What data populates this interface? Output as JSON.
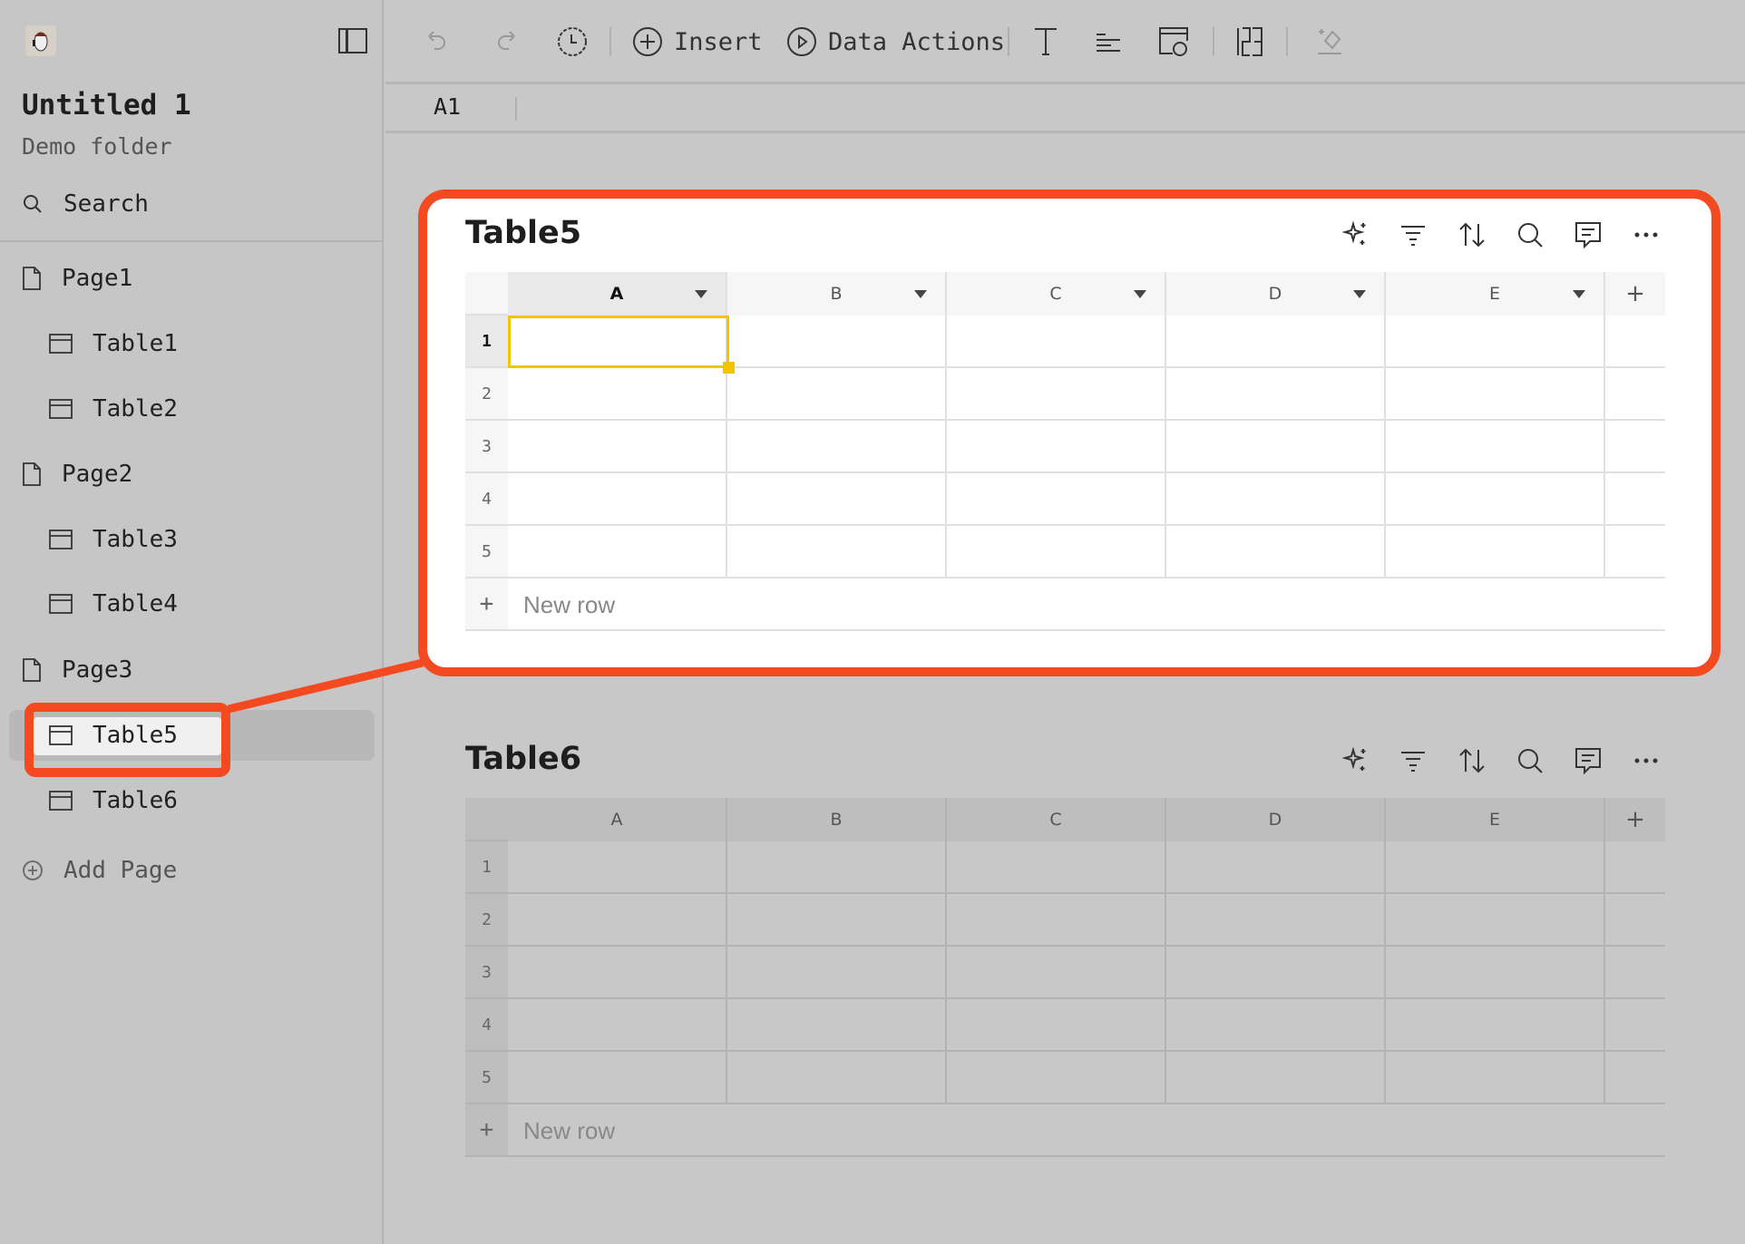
{
  "sidebar": {
    "title": "Untitled 1",
    "folder": "Demo folder",
    "search": "Search",
    "items": [
      {
        "type": "page",
        "label": "Page1"
      },
      {
        "type": "table",
        "label": "Table1"
      },
      {
        "type": "table",
        "label": "Table2"
      },
      {
        "type": "page",
        "label": "Page2"
      },
      {
        "type": "table",
        "label": "Table3"
      },
      {
        "type": "table",
        "label": "Table4"
      },
      {
        "type": "page",
        "label": "Page3"
      },
      {
        "type": "table",
        "label": "Table5",
        "selected": true
      },
      {
        "type": "table",
        "label": "Table6"
      }
    ],
    "add_page": "Add Page"
  },
  "toolbar": {
    "insert": "Insert",
    "data_actions": "Data Actions"
  },
  "formula": {
    "cell_ref": "A1"
  },
  "tables": [
    {
      "title": "Table5",
      "columns": [
        "A",
        "B",
        "C",
        "D",
        "E"
      ],
      "rows": [
        "1",
        "2",
        "3",
        "4",
        "5"
      ],
      "new_row": "New row",
      "selected_cell": "A1",
      "active": true
    },
    {
      "title": "Table6",
      "columns": [
        "A",
        "B",
        "C",
        "D",
        "E"
      ],
      "rows": [
        "1",
        "2",
        "3",
        "4",
        "5"
      ],
      "new_row": "New row",
      "active": false
    }
  ],
  "colors": {
    "highlight": "#f44a22",
    "selection": "#f5c400",
    "background": "#c8c8c8"
  }
}
